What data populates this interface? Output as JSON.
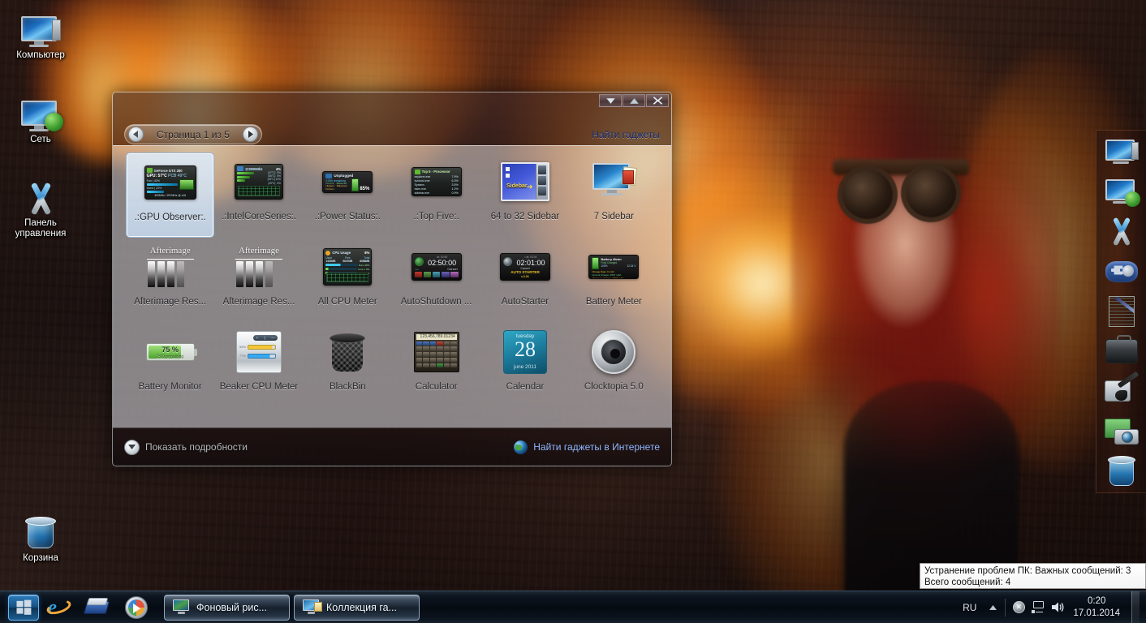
{
  "desktop": {
    "icons": [
      {
        "label": "Компьютер",
        "icon": "computer-icon"
      },
      {
        "label": "Сеть",
        "icon": "network-icon"
      },
      {
        "label": "Панель управления",
        "icon": "control-panel-icon"
      },
      {
        "label": "Корзина",
        "icon": "recycle-bin-icon"
      }
    ]
  },
  "gallery": {
    "window_buttons": {
      "minimize": "▼",
      "maximize": "▲",
      "close": "X"
    },
    "pager": {
      "label": "Страница 1 из 5",
      "prev": "◀",
      "next": "▶"
    },
    "find_gadgets_link": "Найти гаджеты",
    "footer": {
      "show_details": "Показать подробности",
      "online_link": "Найти гаджеты в Интернете"
    },
    "gadgets": [
      {
        "name": ".:GPU Observer:.",
        "art": "gpu",
        "selected": true,
        "art_text": {
          "title": "GeForce GTX 280",
          "gpu": "GPU: 57°C",
          "pcb": "PCB 49°C",
          "fan": "Fan | 40%",
          "used": "Used | 23%",
          "clock": "400MHz / 297MHz @ x16"
        }
      },
      {
        "name": ".:IntelCoreSeries:.",
        "art": "intel",
        "selected": false,
        "art_text": {
          "header": "@2800Mhz",
          "load": "4%",
          "cores": [
            "57°C 0%",
            "55°C 0%",
            "49°C 11%",
            "49°C 0%"
          ]
        }
      },
      {
        "name": ".:Power Status:.",
        "art": "power",
        "selected": false,
        "art_text": {
          "title": "Unplugged",
          "remaining": "2:53h remaining",
          "pct": "85%"
        }
      },
      {
        "name": ".:Top Five:.",
        "art": "top5",
        "selected": false,
        "art_text": {
          "title": "Top 5 - Processor",
          "rows": [
            "explorer.exe 7.9%",
            "svchost.exe 6.3%",
            "System 3.5%",
            "dwm.exe 1.2%",
            "sidebar.exe 0.9%"
          ]
        }
      },
      {
        "name": "64 to 32 Sidebar",
        "art": "sidebar64",
        "selected": false,
        "art_text": {
          "label": "Sidebar"
        }
      },
      {
        "name": "7 Sidebar",
        "art": "sidebar7",
        "selected": false,
        "art_text": {}
      },
      {
        "name": "Afterimage Res...",
        "art": "afterimage",
        "selected": false,
        "art_text": {
          "title": "Afterimage"
        }
      },
      {
        "name": "Afterimage Res...",
        "art": "afterimage",
        "selected": false,
        "art_text": {
          "title": "Afterimage"
        }
      },
      {
        "name": "All CPU Meter",
        "art": "allcpu",
        "selected": false,
        "art_text": {
          "title": "CPU Usage",
          "pct": "8%",
          "used": "Used 1420MB",
          "free": "Free 5647MB",
          "total": "Total 8088MB",
          "ram": "Ram 46%",
          "core1": "Core 1 9%",
          "core2": "Core 2 6%"
        }
      },
      {
        "name": "AutoShutdown ...",
        "art": "autoshutdown",
        "selected": false,
        "art_text": {
          "at": "at: 02:50",
          "time": "02:50:00",
          "cancel": "Cancel"
        }
      },
      {
        "name": "AutoStarter",
        "art": "autostarter",
        "selected": false,
        "art_text": {
          "at": "at: 02:01",
          "time": "02:01:00",
          "cancel": "Cancel",
          "title": "AUTO STARTER",
          "ver": "v.2.01"
        }
      },
      {
        "name": "Battery Meter",
        "art": "batterymeter",
        "selected": false,
        "art_text": {
          "title": "Battery Meter",
          "state": "Fully Charged",
          "pct": "100%",
          "volt": "12.34 V",
          "rate": "Charge Rate: 0 mAh",
          "cur": "Current Charge: 3507 mAh",
          "max": "Maximum Charge: 3507 mAh"
        }
      },
      {
        "name": "Battery Monitor",
        "art": "batterymonitor",
        "selected": false,
        "art_text": {
          "pct": "75 %",
          "remaining": "2:00 remaining"
        }
      },
      {
        "name": "Beaker CPU Meter",
        "art": "beaker",
        "selected": false,
        "art_text": {
          "cpu": "55%",
          "ram": "77%"
        }
      },
      {
        "name": "BlackBin",
        "art": "blackbin",
        "selected": false,
        "art_text": {}
      },
      {
        "name": "Calculator",
        "art": "calculator",
        "selected": false,
        "art_text": {
          "display": "123,456,789.01234"
        }
      },
      {
        "name": "Calendar",
        "art": "calendar",
        "selected": false,
        "art_text": {
          "dow": "tuesday",
          "day": "28",
          "month": "june 2011"
        }
      },
      {
        "name": "Clocktopia 5.0",
        "art": "clocktopia",
        "selected": false,
        "art_text": {}
      }
    ]
  },
  "dock": {
    "items": [
      {
        "icon": "computer-icon"
      },
      {
        "icon": "network-icon"
      },
      {
        "icon": "control-panel-icon"
      },
      {
        "icon": "games-icon"
      },
      {
        "icon": "documents-icon"
      },
      {
        "icon": "briefcase-icon"
      },
      {
        "icon": "music-icon"
      },
      {
        "icon": "pictures-camera-icon"
      },
      {
        "icon": "recycle-bin-icon"
      }
    ]
  },
  "tray_tooltip": {
    "line1": "Устранение проблем ПК: Важных сообщений: 3",
    "line2": "Всего сообщений: 4"
  },
  "taskbar": {
    "start": "start-orb-icon",
    "quick_launch": [
      {
        "icon": "internet-explorer-icon"
      },
      {
        "icon": "explorer-folders-icon"
      },
      {
        "icon": "windows-media-player-icon"
      }
    ],
    "tasks": [
      {
        "label": "Фоновый рис...",
        "icon": "desktop-background-icon"
      },
      {
        "label": "Коллекция га...",
        "icon": "gadget-gallery-icon"
      }
    ],
    "tray": {
      "language": "RU",
      "overflow_arrow": "▲",
      "icons": [
        {
          "icon": "action-center-flag-icon"
        },
        {
          "icon": "network-status-icon"
        },
        {
          "icon": "volume-speaker-icon"
        }
      ],
      "time": "0:20",
      "date": "17.01.2014"
    }
  }
}
